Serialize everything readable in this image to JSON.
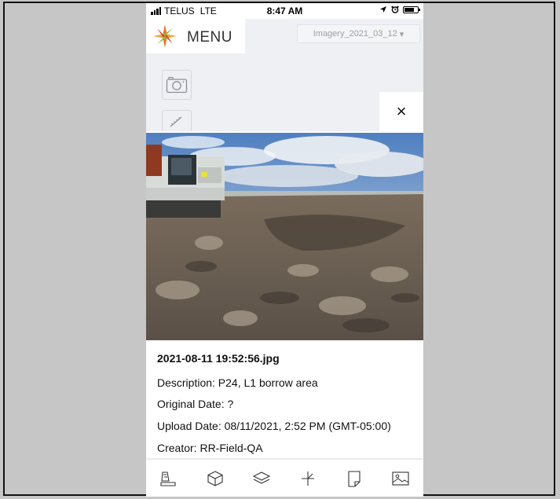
{
  "status_bar": {
    "carrier": "TELUS",
    "network": "LTE",
    "time": "8:47 AM"
  },
  "header": {
    "menu_label": "MENU",
    "imagery_select": "Imagery_2021_03_12",
    "imagery_caret": "▾"
  },
  "photo_panel": {
    "close_label": "×",
    "filename": "2021-08-11 19:52:56.jpg",
    "description": "Description: P24, L1 borrow area",
    "original_date": "Original Date: ?",
    "upload_date": "Upload Date: 08/11/2021, 2:52 PM (GMT-05:00)",
    "creator": "Creator: RR-Field-QA"
  },
  "icons": {
    "tools": [
      "camera-icon",
      "ruler-icon"
    ],
    "bottom_bar": [
      "map-icon",
      "cube-icon",
      "layers-icon",
      "measure-icon",
      "note-icon",
      "image-icon"
    ]
  },
  "colors": {
    "page_background": "#c6c6c6",
    "app_background": "#eef0f3",
    "logo_orange": "#e8742a",
    "logo_green": "#8cbf3f"
  }
}
